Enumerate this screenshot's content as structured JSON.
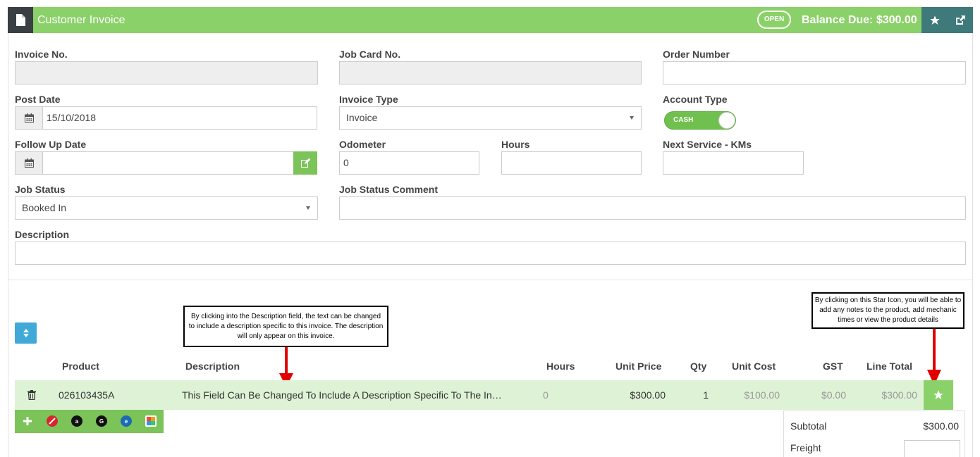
{
  "header": {
    "title": "Customer Invoice",
    "status_badge": "OPEN",
    "balance_due": "Balance Due: $300.00"
  },
  "form": {
    "invoice_no": {
      "label": "Invoice No.",
      "value": ""
    },
    "job_card_no": {
      "label": "Job Card No.",
      "value": ""
    },
    "order_number": {
      "label": "Order Number",
      "value": ""
    },
    "post_date": {
      "label": "Post Date",
      "value": "15/10/2018"
    },
    "invoice_type": {
      "label": "Invoice Type",
      "value": "Invoice"
    },
    "account_type": {
      "label": "Account Type",
      "value": "CASH"
    },
    "follow_up_date": {
      "label": "Follow Up Date",
      "value": ""
    },
    "odometer": {
      "label": "Odometer",
      "value": "0"
    },
    "hours": {
      "label": "Hours",
      "value": ""
    },
    "next_service": {
      "label": "Next Service - KMs",
      "value": ""
    },
    "job_status": {
      "label": "Job Status",
      "value": "Booked In"
    },
    "job_status_comment": {
      "label": "Job Status Comment",
      "value": ""
    },
    "description": {
      "label": "Description",
      "value": ""
    }
  },
  "table": {
    "headers": {
      "product": "Product",
      "description": "Description",
      "hours": "Hours",
      "unit_price": "Unit Price",
      "qty": "Qty",
      "unit_cost": "Unit Cost",
      "gst": "GST",
      "line_total": "Line Total"
    },
    "row": {
      "product": "026103435A",
      "description": "This Field Can Be Changed To Include A Description Specific To The In…",
      "hours": "0",
      "unit_price": "$300.00",
      "qty": "1",
      "unit_cost": "$100.00",
      "gst": "$0.00",
      "line_total": "$300.00"
    }
  },
  "toolbar": {
    "icons": [
      "plus-icon",
      "no-entry-icon",
      "a-plus-icon",
      "g-plus-icon",
      "e-icon",
      "image-icon"
    ],
    "icon_labels": {
      "a": "a",
      "g": "G",
      "e": "e"
    }
  },
  "totals": {
    "subtotal_label": "Subtotal",
    "subtotal_value": "$300.00",
    "freight_label": "Freight"
  },
  "callouts": {
    "description": "By clicking into the Description field, the text can be changed to include a description specific to this invoice. The description will only appear on this invoice.",
    "star": "By clicking on this Star Icon, you will be able to add any notes to the product, add mechanic times or view the product details"
  },
  "colors": {
    "brand_green": "#8bd16a",
    "dark_teal": "#3d7a79",
    "row_highlight": "#def2d6",
    "sort_blue": "#3fa9d8",
    "arrow_red": "#e00000"
  }
}
